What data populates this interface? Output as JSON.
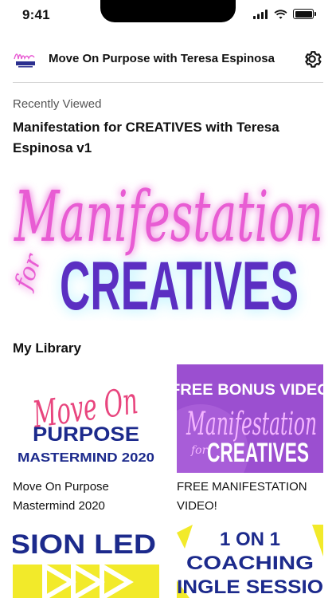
{
  "status_bar": {
    "time": "9:41"
  },
  "header": {
    "title": "Move On Purpose with Teresa Espinosa"
  },
  "recently_viewed": {
    "label": "Recently Viewed",
    "title": "Manifestation for CREATIVES with Teresa Espinosa v1",
    "hero": {
      "script_text": "Manifestation",
      "for_text": "for",
      "block_text": "CREATIVES"
    }
  },
  "library": {
    "heading": "My Library",
    "items": [
      {
        "title": "Move On Purpose Mastermind 2020",
        "art_script": "Move On",
        "art_block": "PURPOSE",
        "art_sub": "MASTERMIND 2020"
      },
      {
        "title": "FREE MANIFESTATION VIDEO!",
        "art_banner": "FREE BONUS VIDEO",
        "art_script": "Manifestation",
        "art_for": "for",
        "art_block": "CREATIVES"
      },
      {
        "art_text": "SION LED"
      },
      {
        "art_line1": "1 ON 1",
        "art_line2": "COACHING",
        "art_line3": "INGLE SESSIO"
      }
    ]
  },
  "colors": {
    "accent_pink": "#e85bd3",
    "accent_purple": "#5b2fc2",
    "navy": "#1c2a8c",
    "yellow": "#f2ea2a"
  }
}
